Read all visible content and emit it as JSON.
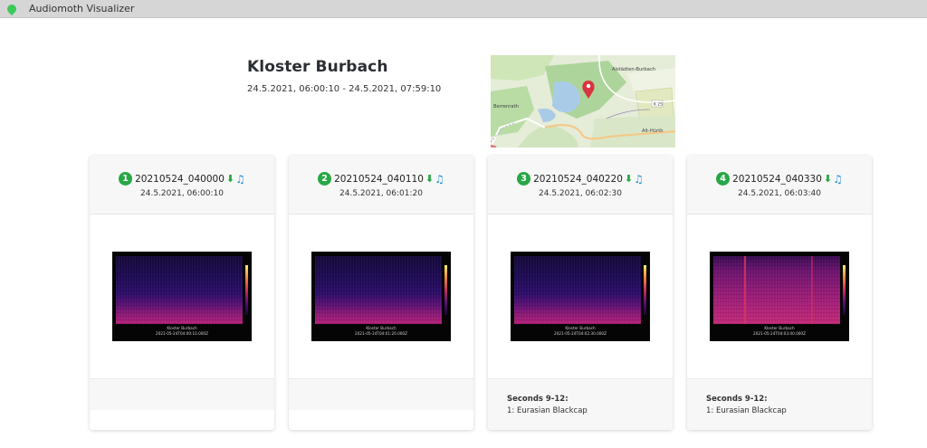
{
  "window": {
    "title": "Audiomoth Visualizer"
  },
  "location": {
    "name": "Kloster Burbach",
    "range": "24.5.2021, 06:00:10 - 24.5.2021, 07:59:10"
  },
  "map": {
    "labels": {
      "town1": "Alstädten-Burbach",
      "town2": "Berrenrath",
      "town3": "Alt-Hürth",
      "road": "K 25"
    },
    "pin_icon": "map-pin-icon"
  },
  "recordings": [
    {
      "index": "1",
      "name": "20210524_040000",
      "time": "24.5.2021, 06:00:10",
      "caption1": "Kloster Burbach",
      "caption2": "2021-05-24T04:00:10.000Z",
      "detections_title": "",
      "detections": []
    },
    {
      "index": "2",
      "name": "20210524_040110",
      "time": "24.5.2021, 06:01:20",
      "caption1": "Kloster Burbach",
      "caption2": "2021-05-24T04:01:20.000Z",
      "detections_title": "",
      "detections": []
    },
    {
      "index": "3",
      "name": "20210524_040220",
      "time": "24.5.2021, 06:02:30",
      "caption1": "Kloster Burbach",
      "caption2": "2021-05-24T04:02:30.000Z",
      "detections_title": "Seconds 9-12:",
      "detections": [
        "1: Eurasian Blackcap"
      ]
    },
    {
      "index": "4",
      "name": "20210524_040330",
      "time": "24.5.2021, 06:03:40",
      "caption1": "Kloster Burbach",
      "caption2": "2021-05-24T04:03:40.000Z",
      "detections_title": "Seconds 9-12:",
      "detections": [
        "1: Eurasian Blackcap"
      ]
    }
  ],
  "icons": {
    "download": "download-icon",
    "play": "music-note-icon"
  },
  "colors": {
    "badge": "#28a745",
    "download": "#28a745",
    "music": "#1e8fd6",
    "logo": "#3cc95a"
  }
}
